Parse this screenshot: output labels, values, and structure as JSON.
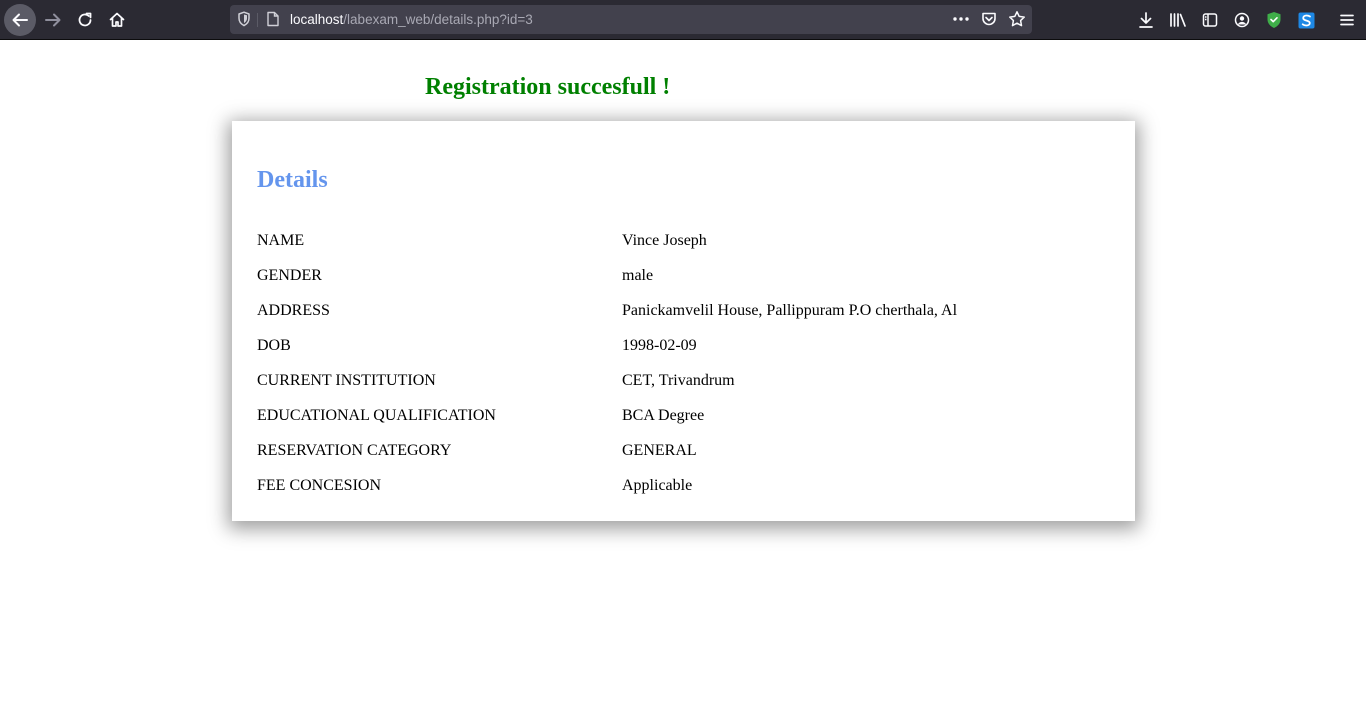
{
  "browser": {
    "url_host": "localhost",
    "url_path": "/labexam_web/details.php?id=3",
    "icons": {
      "back": "arrow-left-icon",
      "forward": "arrow-right-icon",
      "reload": "reload-icon",
      "home": "home-icon",
      "tracking": "shield-icon",
      "page": "page-icon",
      "more": "more-dots-icon",
      "pocket": "pocket-icon",
      "bookmark": "star-icon",
      "downloads": "download-icon",
      "library": "library-icon",
      "sidebar": "sidebar-icon",
      "account": "account-icon",
      "extension_shield": "green-shield-icon",
      "extension_s": "s-extension-icon",
      "menu": "hamburger-menu-icon"
    }
  },
  "page": {
    "success_message": "Registration succesfull !",
    "details_title": "Details",
    "rows": [
      {
        "label": "NAME",
        "value": "Vince Joseph"
      },
      {
        "label": "GENDER",
        "value": "male"
      },
      {
        "label": "ADDRESS",
        "value": "Panickamvelil House, Pallippuram P.O cherthala, Al"
      },
      {
        "label": "DOB",
        "value": "1998-02-09"
      },
      {
        "label": "CURRENT INSTITUTION",
        "value": "CET, Trivandrum"
      },
      {
        "label": "EDUCATIONAL QUALIFICATION",
        "value": "BCA Degree"
      },
      {
        "label": "RESERVATION CATEGORY",
        "value": "GENERAL"
      },
      {
        "label": "FEE CONCESION",
        "value": "Applicable"
      }
    ]
  },
  "colors": {
    "success": "#008000",
    "title": "#6495ed",
    "toolbar": "#2b2a33",
    "urlbar": "#42414d"
  }
}
